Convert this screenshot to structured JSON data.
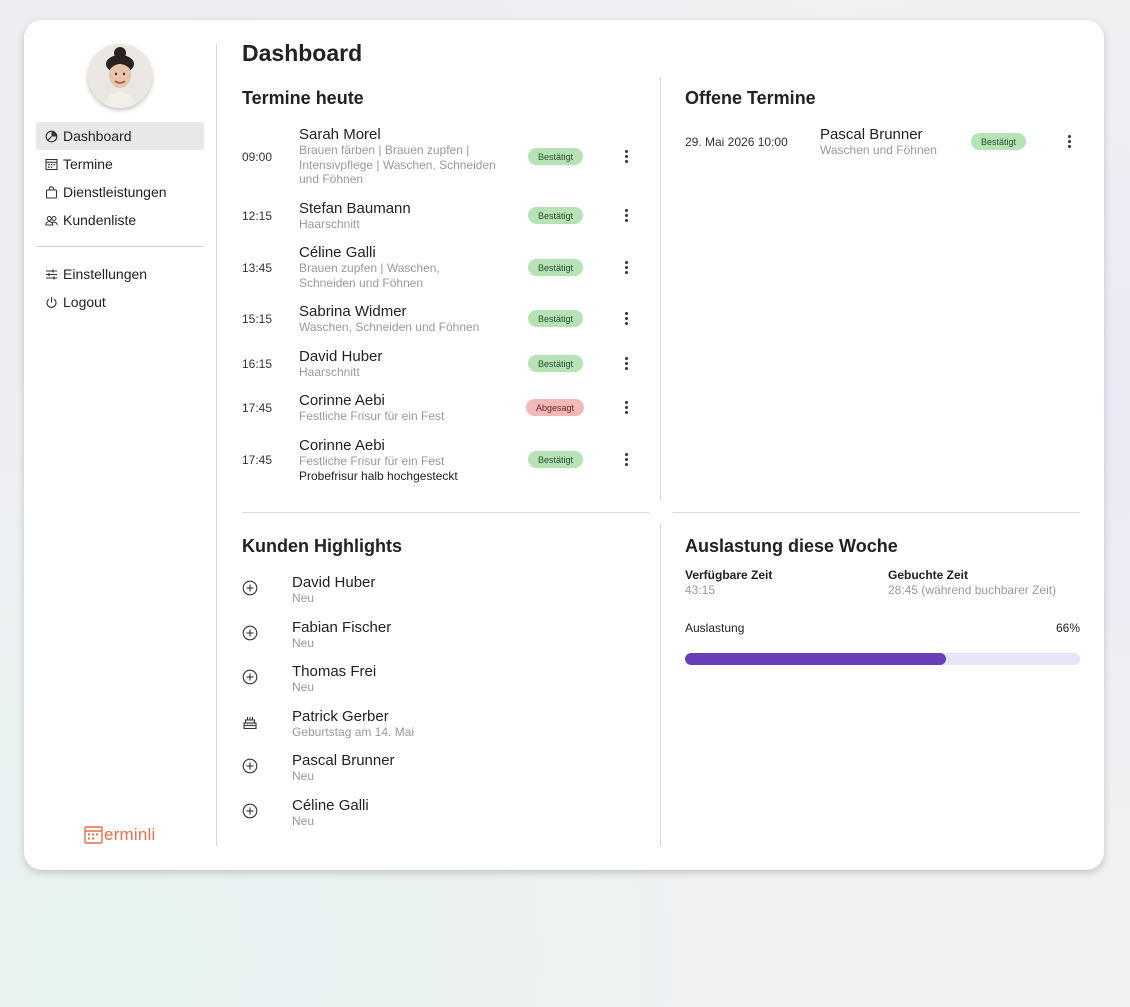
{
  "sidebar": {
    "items": [
      {
        "label": "Dashboard",
        "icon": "dashboard-pie-icon"
      },
      {
        "label": "Termine",
        "icon": "calendar-icon"
      },
      {
        "label": "Dienstleistungen",
        "icon": "bag-icon"
      },
      {
        "label": "Kundenliste",
        "icon": "users-icon"
      }
    ],
    "settings_label": "Einstellungen",
    "logout_label": "Logout",
    "brand": "erminli"
  },
  "page_title": "Dashboard",
  "today": {
    "title": "Termine heute",
    "appointments": [
      {
        "time": "09:00",
        "name": "Sarah Morel",
        "service": "Brauen färben | Brauen zupfen | Intensivpflege | Waschen, Schneiden und Föhnen",
        "status": "Bestätigt"
      },
      {
        "time": "12:15",
        "name": "Stefan Baumann",
        "service": "Haarschnitt",
        "status": "Bestätigt"
      },
      {
        "time": "13:45",
        "name": "Céline Galli",
        "service": "Brauen zupfen | Waschen, Schneiden und Föhnen",
        "status": "Bestätigt"
      },
      {
        "time": "15:15",
        "name": "Sabrina Widmer",
        "service": "Waschen, Schneiden und Föhnen",
        "status": "Bestätigt"
      },
      {
        "time": "16:15",
        "name": "David Huber",
        "service": "Haarschnitt",
        "status": "Bestätigt"
      },
      {
        "time": "17:45",
        "name": "Corinne Aebi",
        "service": "Festliche Frisur für ein Fest",
        "status": "Abgesagt"
      },
      {
        "time": "17:45",
        "name": "Corinne Aebi",
        "service": "Festliche Frisur für ein Fest",
        "note": "Probefrisur halb hochgesteckt",
        "status": "Bestätigt"
      }
    ]
  },
  "open": {
    "title": "Offene Termine",
    "appointments": [
      {
        "date": "29. Mai 2026 10:00",
        "name": "Pascal Brunner",
        "service": "Waschen und Föhnen",
        "status": "Bestätigt"
      }
    ]
  },
  "highlights": {
    "title": "Kunden Highlights",
    "items": [
      {
        "name": "David Huber",
        "sub": "Neu",
        "icon": "plus-circle-icon"
      },
      {
        "name": "Fabian Fischer",
        "sub": "Neu",
        "icon": "plus-circle-icon"
      },
      {
        "name": "Thomas Frei",
        "sub": "Neu",
        "icon": "plus-circle-icon"
      },
      {
        "name": "Patrick Gerber",
        "sub": "Geburtstag am 14. Mai",
        "icon": "birthday-cake-icon"
      },
      {
        "name": "Pascal Brunner",
        "sub": "Neu",
        "icon": "plus-circle-icon"
      },
      {
        "name": "Céline Galli",
        "sub": "Neu",
        "icon": "plus-circle-icon"
      }
    ]
  },
  "utilization": {
    "title": "Auslastung diese Woche",
    "available_label": "Verfügbare Zeit",
    "available_value": "43:15",
    "booked_label": "Gebuchte Zeit",
    "booked_value": "28:45 (während buchbarer Zeit)",
    "load_label": "Auslastung",
    "load_value": "66%",
    "load_fraction": 0.66,
    "bar_color": "#6a3db8",
    "track_color": "#e8e4f7"
  },
  "colors": {
    "confirmed_bg": "#b5e3b5",
    "cancelled_bg": "#f5b8b8",
    "brand": "#e0714a"
  }
}
